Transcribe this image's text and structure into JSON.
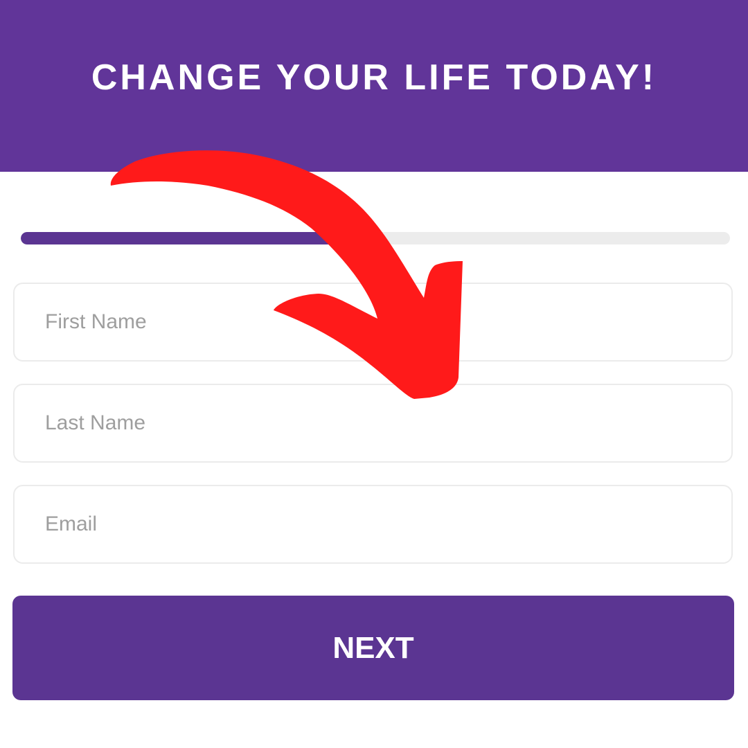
{
  "header": {
    "title": "CHANGE YOUR LIFE TODAY!"
  },
  "progress": {
    "percent": 50,
    "fill_color": "#5b3592",
    "track_color": "#ececec"
  },
  "form": {
    "fields": [
      {
        "placeholder": "First Name",
        "value": ""
      },
      {
        "placeholder": "Last Name",
        "value": ""
      },
      {
        "placeholder": "Email",
        "value": ""
      }
    ],
    "next_label": "NEXT"
  },
  "annotation": {
    "icon": "curved-arrow-icon",
    "color": "#ff1a1a"
  },
  "colors": {
    "brand": "#613599"
  }
}
